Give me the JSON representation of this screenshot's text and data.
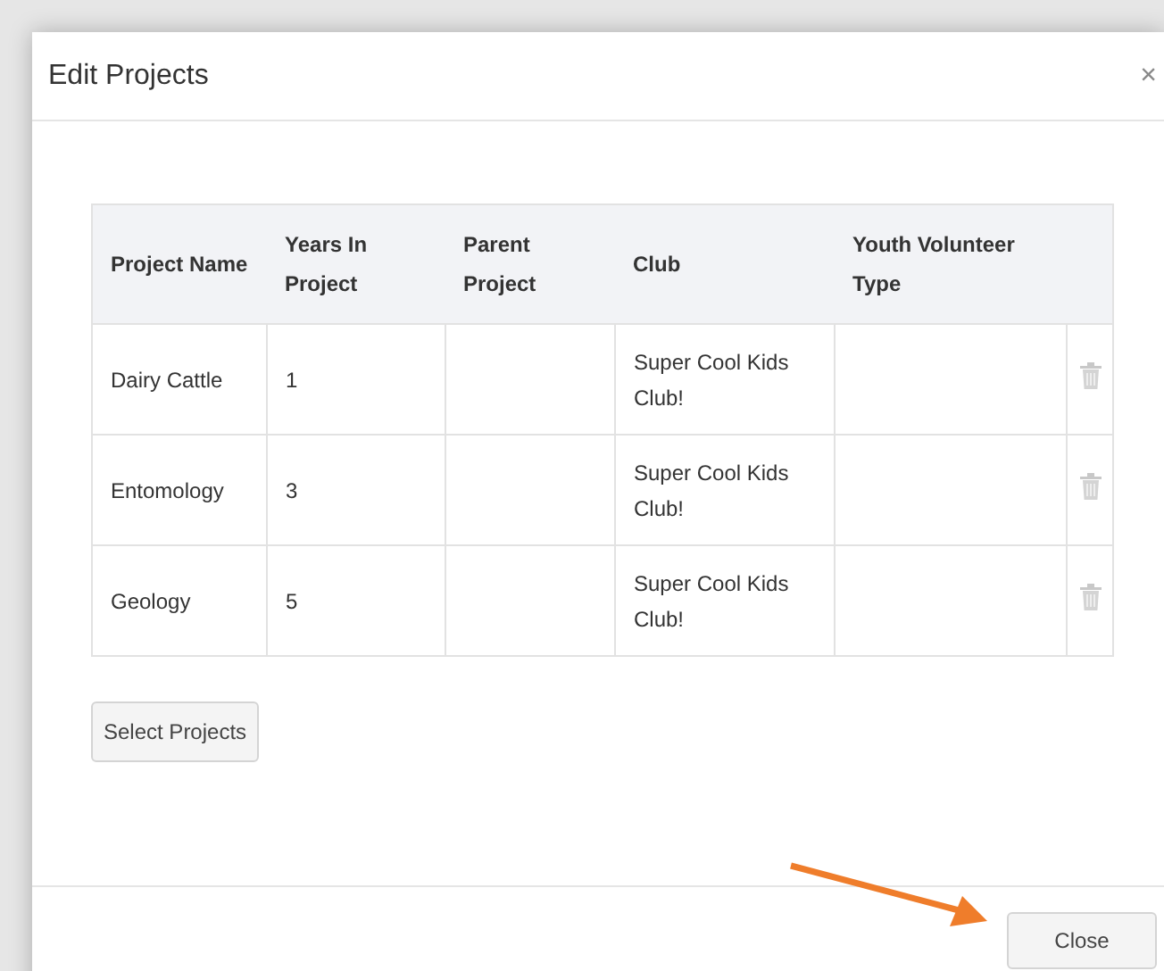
{
  "dialog": {
    "title": "Edit Projects",
    "close_glyph": "×"
  },
  "table": {
    "columns": [
      "Project Name",
      "Years In Project",
      "Parent Project",
      "Club",
      "Youth Volunteer Type"
    ],
    "rows": [
      {
        "cells": [
          "Dairy Cattle",
          "1",
          "",
          "Super Cool Kids Club!",
          ""
        ]
      },
      {
        "cells": [
          "Entomology",
          "3",
          "",
          "Super Cool Kids Club!",
          ""
        ]
      },
      {
        "cells": [
          "Geology",
          "5",
          "",
          "Super Cool Kids Club!",
          ""
        ]
      }
    ]
  },
  "select_button": "Select Projects",
  "footer_button": "Close"
}
